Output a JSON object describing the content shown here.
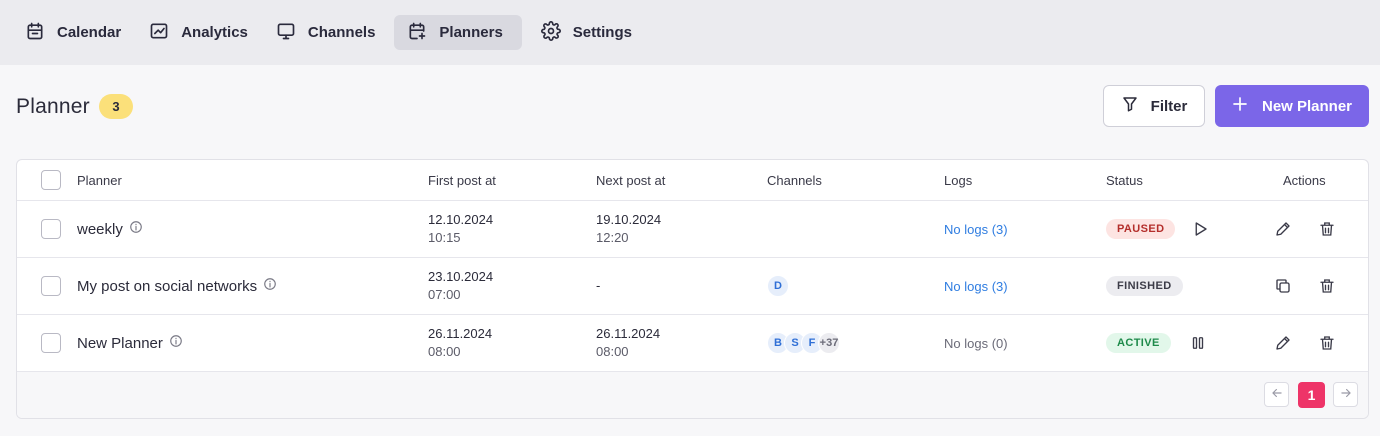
{
  "nav": {
    "items": [
      {
        "label": "Calendar",
        "icon": "calendar-icon"
      },
      {
        "label": "Analytics",
        "icon": "analytics-icon"
      },
      {
        "label": "Channels",
        "icon": "monitor-icon"
      },
      {
        "label": "Planners",
        "icon": "calendar-plus-icon",
        "active": true
      },
      {
        "label": "Settings",
        "icon": "gear-icon"
      }
    ]
  },
  "header": {
    "title": "Planner",
    "count": "3",
    "filter_label": "Filter",
    "new_label": "New Planner"
  },
  "table": {
    "columns": [
      "Planner",
      "First post at",
      "Next post at",
      "Channels",
      "Logs",
      "Status",
      "Actions"
    ],
    "rows": [
      {
        "name": "weekly",
        "first_date": "12.10.2024",
        "first_time": "10:15",
        "next_date": "19.10.2024",
        "next_time": "12:20",
        "channels": [],
        "logs": "No logs (3)",
        "status": "PAUSED"
      },
      {
        "name": "My post on social networks",
        "first_date": "23.10.2024",
        "first_time": "07:00",
        "next_date": "-",
        "next_time": "",
        "channels": [
          "D"
        ],
        "logs": "No logs (3)",
        "status": "FINISHED"
      },
      {
        "name": "New Planner",
        "first_date": "26.11.2024",
        "first_time": "08:00",
        "next_date": "26.11.2024",
        "next_time": "08:00",
        "channels": [
          "B",
          "S",
          "F"
        ],
        "channels_more": "+37",
        "logs": "No logs (0)",
        "status": "ACTIVE"
      }
    ]
  },
  "pagination": {
    "current_page": "1",
    "prev_icon": "arrow-left-icon",
    "next_icon": "arrow-right-icon"
  },
  "colors": {
    "accent": "#7b66e8",
    "page_active": "#ee3468",
    "badge": "#fbe07a",
    "link": "#2f7de1"
  }
}
